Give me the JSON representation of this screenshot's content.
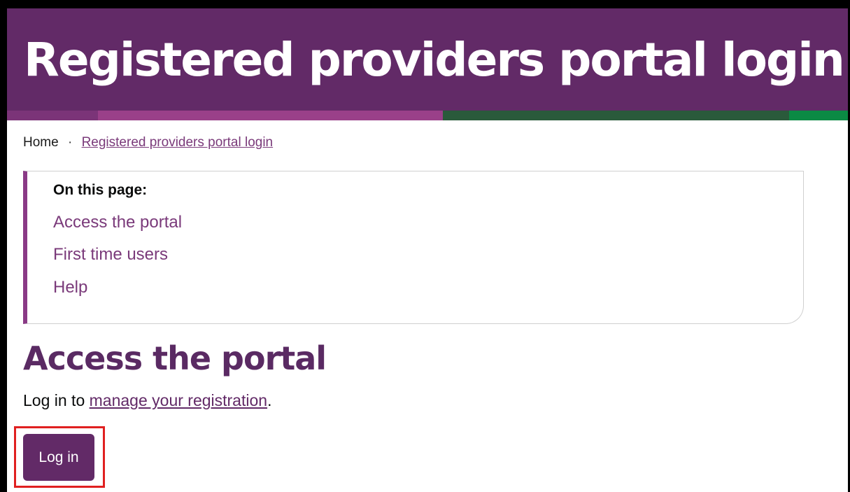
{
  "header": {
    "title": "Registered providers portal login"
  },
  "breadcrumb": {
    "home": "Home",
    "separator": "·",
    "current": "Registered providers portal login"
  },
  "toc": {
    "heading": "On this page:",
    "links": [
      "Access the portal",
      "First time users",
      "Help"
    ]
  },
  "main": {
    "section_title": "Access the portal",
    "intro_prefix": "Log in to ",
    "intro_link": "manage your registration",
    "intro_suffix": ".",
    "login_button": "Log in"
  },
  "colors": {
    "brand_purple": "#622a67",
    "link_purple": "#7a3a7a",
    "stripe_magenta": "#9a4089",
    "stripe_dark_green": "#2a5a3b",
    "stripe_green": "#0b8a44",
    "highlight_red": "#e02020"
  }
}
